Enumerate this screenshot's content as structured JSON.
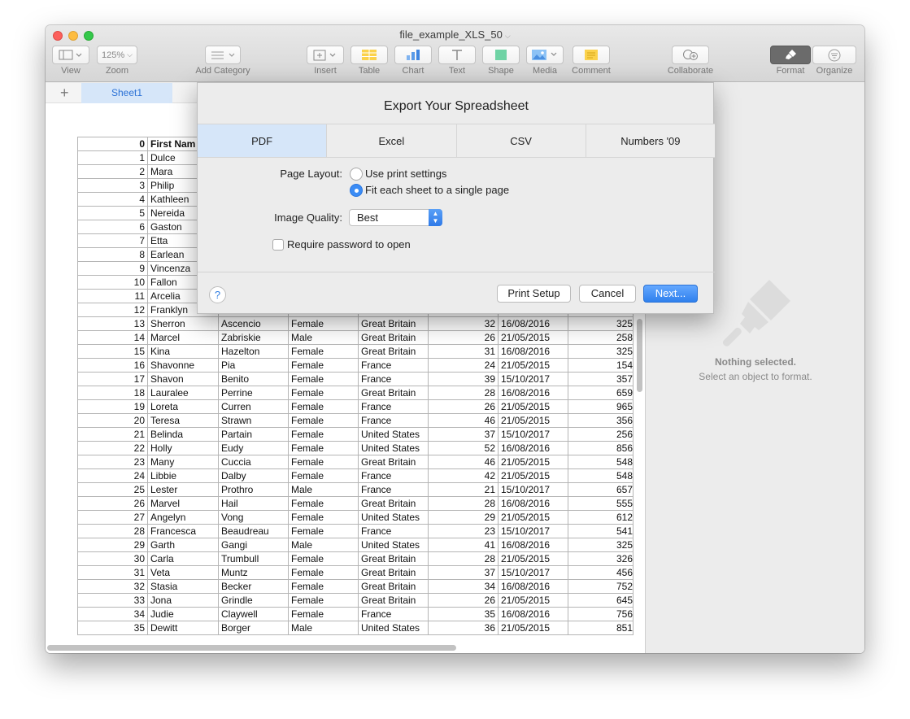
{
  "window": {
    "title": "file_example_XLS_50"
  },
  "toolbar": {
    "view_label": "View",
    "zoom_value": "125%",
    "zoom_label": "Zoom",
    "add_category_label": "Add Category",
    "insert_label": "Insert",
    "table_label": "Table",
    "chart_label": "Chart",
    "text_label": "Text",
    "shape_label": "Shape",
    "media_label": "Media",
    "comment_label": "Comment",
    "collaborate_label": "Collaborate",
    "format_label": "Format",
    "organize_label": "Organize"
  },
  "sheet_tabs": {
    "add": "+",
    "active": "Sheet1"
  },
  "sidebar": {
    "title": "Nothing selected.",
    "subtitle": "Select an object to format."
  },
  "table": {
    "header": [
      "0",
      "First Nam"
    ],
    "rows": [
      [
        "1",
        "Dulce",
        "",
        "",
        "",
        "",
        "",
        ""
      ],
      [
        "2",
        "Mara",
        "",
        "",
        "",
        "",
        "",
        ""
      ],
      [
        "3",
        "Philip",
        "",
        "",
        "",
        "",
        "",
        ""
      ],
      [
        "4",
        "Kathleen",
        "",
        "",
        "",
        "",
        "",
        ""
      ],
      [
        "5",
        "Nereida",
        "",
        "",
        "",
        "",
        "",
        ""
      ],
      [
        "6",
        "Gaston",
        "",
        "",
        "",
        "",
        "",
        ""
      ],
      [
        "7",
        "Etta",
        "",
        "",
        "",
        "",
        "",
        ""
      ],
      [
        "8",
        "Earlean",
        "",
        "",
        "",
        "",
        "",
        ""
      ],
      [
        "9",
        "Vincenza",
        "",
        "",
        "",
        "",
        "",
        ""
      ],
      [
        "10",
        "Fallon",
        "",
        "",
        "",
        "",
        "",
        ""
      ],
      [
        "11",
        "Arcelia",
        "",
        "",
        "",
        "",
        "",
        ""
      ],
      [
        "12",
        "Franklyn",
        "",
        "",
        "",
        "",
        "",
        ""
      ],
      [
        "13",
        "Sherron",
        "Ascencio",
        "Female",
        "Great Britain",
        "32",
        "16/08/2016",
        "325"
      ],
      [
        "14",
        "Marcel",
        "Zabriskie",
        "Male",
        "Great Britain",
        "26",
        "21/05/2015",
        "258"
      ],
      [
        "15",
        "Kina",
        "Hazelton",
        "Female",
        "Great Britain",
        "31",
        "16/08/2016",
        "325"
      ],
      [
        "16",
        "Shavonne",
        "Pia",
        "Female",
        "France",
        "24",
        "21/05/2015",
        "154"
      ],
      [
        "17",
        "Shavon",
        "Benito",
        "Female",
        "France",
        "39",
        "15/10/2017",
        "357"
      ],
      [
        "18",
        "Lauralee",
        "Perrine",
        "Female",
        "Great Britain",
        "28",
        "16/08/2016",
        "659"
      ],
      [
        "19",
        "Loreta",
        "Curren",
        "Female",
        "France",
        "26",
        "21/05/2015",
        "965"
      ],
      [
        "20",
        "Teresa",
        "Strawn",
        "Female",
        "France",
        "46",
        "21/05/2015",
        "356"
      ],
      [
        "21",
        "Belinda",
        "Partain",
        "Female",
        "United States",
        "37",
        "15/10/2017",
        "256"
      ],
      [
        "22",
        "Holly",
        "Eudy",
        "Female",
        "United States",
        "52",
        "16/08/2016",
        "856"
      ],
      [
        "23",
        "Many",
        "Cuccia",
        "Female",
        "Great Britain",
        "46",
        "21/05/2015",
        "548"
      ],
      [
        "24",
        "Libbie",
        "Dalby",
        "Female",
        "France",
        "42",
        "21/05/2015",
        "548"
      ],
      [
        "25",
        "Lester",
        "Prothro",
        "Male",
        "France",
        "21",
        "15/10/2017",
        "657"
      ],
      [
        "26",
        "Marvel",
        "Hail",
        "Female",
        "Great Britain",
        "28",
        "16/08/2016",
        "555"
      ],
      [
        "27",
        "Angelyn",
        "Vong",
        "Female",
        "United States",
        "29",
        "21/05/2015",
        "612"
      ],
      [
        "28",
        "Francesca",
        "Beaudreau",
        "Female",
        "France",
        "23",
        "15/10/2017",
        "541"
      ],
      [
        "29",
        "Garth",
        "Gangi",
        "Male",
        "United States",
        "41",
        "16/08/2016",
        "325"
      ],
      [
        "30",
        "Carla",
        "Trumbull",
        "Female",
        "Great Britain",
        "28",
        "21/05/2015",
        "326"
      ],
      [
        "31",
        "Veta",
        "Muntz",
        "Female",
        "Great Britain",
        "37",
        "15/10/2017",
        "456"
      ],
      [
        "32",
        "Stasia",
        "Becker",
        "Female",
        "Great Britain",
        "34",
        "16/08/2016",
        "752"
      ],
      [
        "33",
        "Jona",
        "Grindle",
        "Female",
        "Great Britain",
        "26",
        "21/05/2015",
        "645"
      ],
      [
        "34",
        "Judie",
        "Claywell",
        "Female",
        "France",
        "35",
        "16/08/2016",
        "756"
      ],
      [
        "35",
        "Dewitt",
        "Borger",
        "Male",
        "United States",
        "36",
        "21/05/2015",
        "851"
      ]
    ]
  },
  "dialog": {
    "title": "Export Your Spreadsheet",
    "tabs": [
      "PDF",
      "Excel",
      "CSV",
      "Numbers '09"
    ],
    "page_layout_label": "Page Layout:",
    "option_print": "Use print settings",
    "option_fit": "Fit each sheet to a single page",
    "image_quality_label": "Image Quality:",
    "image_quality_value": "Best",
    "require_password": "Require password to open",
    "help": "?",
    "print_setup": "Print Setup",
    "cancel": "Cancel",
    "next": "Next..."
  },
  "colors": {
    "accent": "#3b8cf5",
    "selected_tab": "#d6e6f9"
  }
}
